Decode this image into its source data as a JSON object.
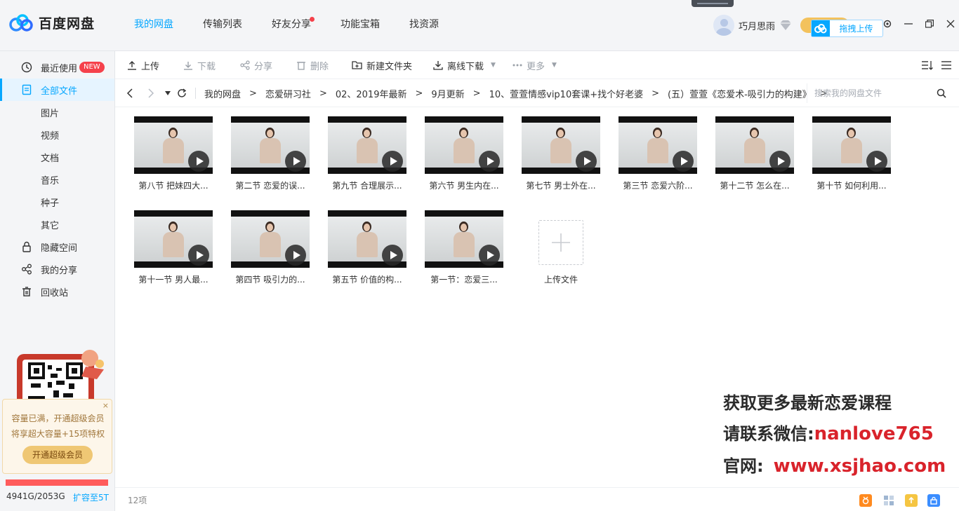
{
  "app": {
    "name": "百度网盘"
  },
  "header": {
    "nav": [
      {
        "label": "我的网盘",
        "active": true
      },
      {
        "label": "传输列表",
        "active": false
      },
      {
        "label": "好友分享",
        "active": false,
        "dot": true
      },
      {
        "label": "功能宝箱",
        "active": false
      },
      {
        "label": "找资源",
        "active": false
      }
    ],
    "username": "巧月思雨",
    "drag_upload": "拖拽上传"
  },
  "sidebar": {
    "items": [
      {
        "label": "最近使用",
        "badge": "NEW"
      },
      {
        "label": "全部文件",
        "active": true
      },
      {
        "label": "图片"
      },
      {
        "label": "视频"
      },
      {
        "label": "文档"
      },
      {
        "label": "音乐"
      },
      {
        "label": "种子"
      },
      {
        "label": "其它"
      },
      {
        "label": "隐藏空间"
      },
      {
        "label": "我的分享"
      },
      {
        "label": "回收站"
      }
    ],
    "promo": {
      "line1": "容量已满，开通超级会员",
      "line2": "将享超大容量+15项特权",
      "button": "开通超级会员",
      "close": "×"
    },
    "quota": {
      "used": "4941G/2053G",
      "expand": "扩容至5T"
    }
  },
  "toolbar": {
    "upload": "上传",
    "download": "下载",
    "share": "分享",
    "delete": "删除",
    "new_folder": "新建文件夹",
    "offline_download": "离线下载",
    "more": "更多"
  },
  "path": {
    "crumbs": [
      "我的网盘",
      "恋爱研习社",
      "02、2019年最新",
      "9月更新",
      "10、萱萱情感vip10套课+找个好老婆",
      "(五）萱萱《恋爱术-吸引力的构建》"
    ],
    "separator": ">",
    "search_placeholder": "搜索我的网盘文件"
  },
  "files": [
    {
      "name": "第八节 把妹四大..."
    },
    {
      "name": "第二节 恋爱的误..."
    },
    {
      "name": "第九节 合理展示..."
    },
    {
      "name": "第六节 男生内在..."
    },
    {
      "name": "第七节 男士外在..."
    },
    {
      "name": "第三节 恋爱六阶..."
    },
    {
      "name": "第十二节 怎么在..."
    },
    {
      "name": "第十节 如何利用..."
    },
    {
      "name": "第十一节 男人最..."
    },
    {
      "name": "第四节 吸引力的..."
    },
    {
      "name": "第五节 价值的构..."
    },
    {
      "name": "第一节：恋爱三..."
    }
  ],
  "upload_tile": "上传文件",
  "status": {
    "count": "12项"
  },
  "watermark": {
    "line1": "获取更多最新恋爱课程",
    "line2_key": "请联系微信:",
    "line2_val": "nanlove765",
    "line3_key": "官网:",
    "line3_val": "www.xsjhao.com"
  }
}
